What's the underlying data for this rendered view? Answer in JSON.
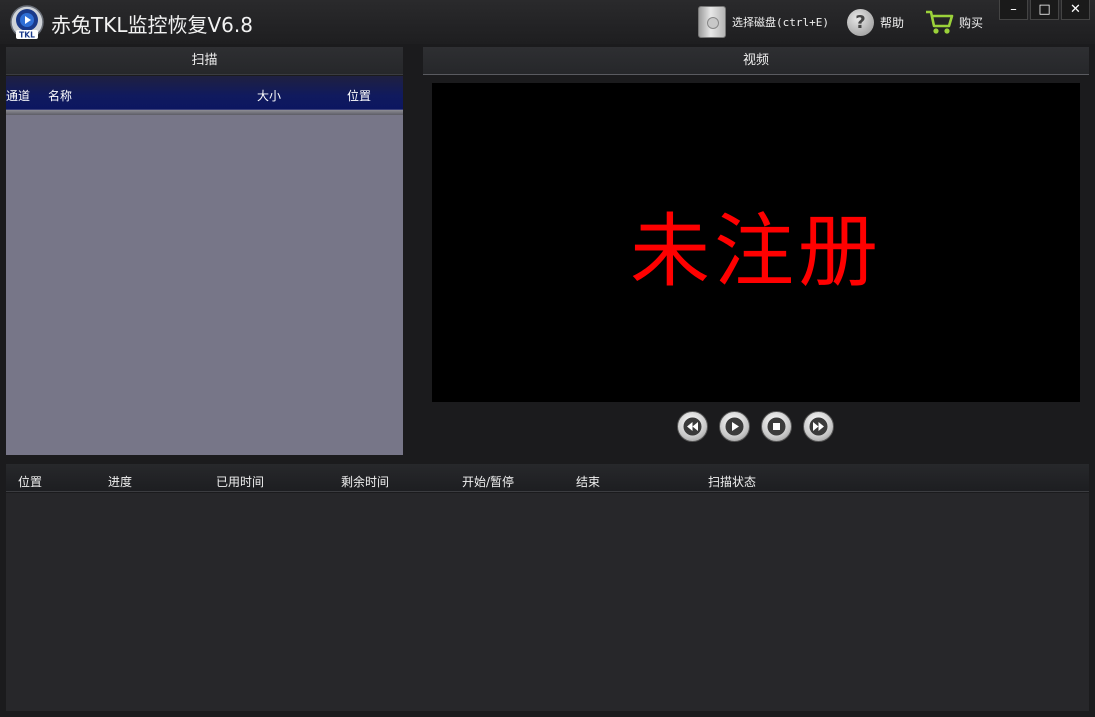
{
  "app": {
    "logo_text": "TKL",
    "title": "赤兔TKL监控恢复V6.8"
  },
  "toolbar": {
    "select_disk": "选择磁盘(ctrl+E)",
    "help": "帮助",
    "buy": "购买"
  },
  "window_controls": {
    "minimize": "–",
    "maximize": "□",
    "close": "✕"
  },
  "scan_panel": {
    "title": "扫描",
    "columns": [
      "通道",
      "名称",
      "大小",
      "位置"
    ]
  },
  "video_panel": {
    "title": "视频",
    "watermark": "未注册",
    "watermark_color": "#ff0000"
  },
  "player_controls": [
    "rewind-icon",
    "play-icon",
    "stop-icon",
    "fast-forward-icon"
  ],
  "task_table": {
    "columns": [
      "位置",
      "进度",
      "已用时间",
      "剩余时间",
      "开始/暂停",
      "结束",
      "扫描状态"
    ]
  },
  "colors": {
    "scan_header_accent": "#0c1660",
    "scan_list_bg": "#777688"
  }
}
